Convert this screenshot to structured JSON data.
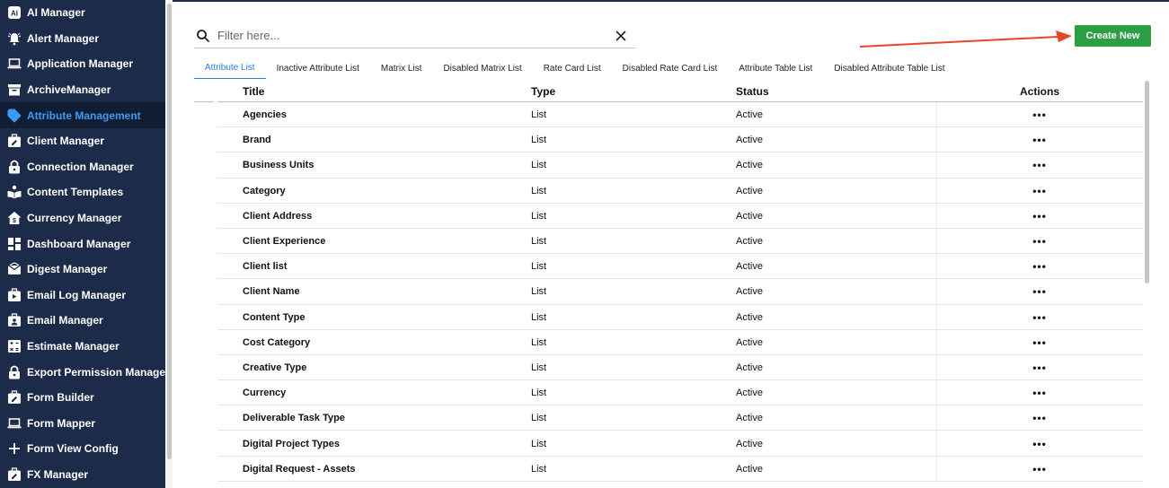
{
  "sidebar": {
    "items": [
      {
        "label": "AI Manager",
        "icon": "ai-icon",
        "active": false
      },
      {
        "label": "Alert Manager",
        "icon": "bell-icon",
        "active": false
      },
      {
        "label": "Application Manager",
        "icon": "laptop-icon",
        "active": false
      },
      {
        "label": "ArchiveManager",
        "icon": "archive-icon",
        "active": false
      },
      {
        "label": "Attribute Management",
        "icon": "tag-icon",
        "active": true
      },
      {
        "label": "Client Manager",
        "icon": "briefcase-edit-icon",
        "active": false
      },
      {
        "label": "Connection Manager",
        "icon": "lock-icon",
        "active": false
      },
      {
        "label": "Content Templates",
        "icon": "book-reader-icon",
        "active": false
      },
      {
        "label": "Currency Manager",
        "icon": "house-dollar-icon",
        "active": false
      },
      {
        "label": "Dashboard Manager",
        "icon": "dashboard-icon",
        "active": false
      },
      {
        "label": "Digest Manager",
        "icon": "digest-icon",
        "active": false
      },
      {
        "label": "Email Log Manager",
        "icon": "briefcase-play-icon",
        "active": false
      },
      {
        "label": "Email Manager",
        "icon": "briefcase-user-icon",
        "active": false
      },
      {
        "label": "Estimate Manager",
        "icon": "calculator-icon",
        "active": false
      },
      {
        "label": "Export Permission Manager",
        "icon": "lock-icon",
        "active": false
      },
      {
        "label": "Form Builder",
        "icon": "briefcase-edit-icon",
        "active": false
      },
      {
        "label": "Form Mapper",
        "icon": "laptop-icon",
        "active": false
      },
      {
        "label": "Form View Config",
        "icon": "plus-icon",
        "active": false
      },
      {
        "label": "FX Manager",
        "icon": "briefcase-edit-icon",
        "active": false
      }
    ]
  },
  "search": {
    "placeholder": "Filter here...",
    "value": ""
  },
  "create_button": {
    "label": "Create New",
    "color": "#2e9e46"
  },
  "tabs": [
    {
      "label": "Attribute List",
      "active": true
    },
    {
      "label": "Inactive Attribute List",
      "active": false
    },
    {
      "label": "Matrix List",
      "active": false
    },
    {
      "label": "Disabled Matrix List",
      "active": false
    },
    {
      "label": "Rate Card List",
      "active": false
    },
    {
      "label": "Disabled Rate Card List",
      "active": false
    },
    {
      "label": "Attribute Table List",
      "active": false
    },
    {
      "label": "Disabled Attribute Table List",
      "active": false
    }
  ],
  "table": {
    "headers": {
      "title": "Title",
      "type": "Type",
      "status": "Status",
      "actions": "Actions"
    },
    "rows": [
      {
        "title": "Agencies",
        "type": "List",
        "status": "Active",
        "actions": "•••"
      },
      {
        "title": "Brand",
        "type": "List",
        "status": "Active",
        "actions": "•••"
      },
      {
        "title": "Business Units",
        "type": "List",
        "status": "Active",
        "actions": "•••"
      },
      {
        "title": "Category",
        "type": "List",
        "status": "Active",
        "actions": "•••"
      },
      {
        "title": "Client Address",
        "type": "List",
        "status": "Active",
        "actions": "•••"
      },
      {
        "title": "Client Experience",
        "type": "List",
        "status": "Active",
        "actions": "•••"
      },
      {
        "title": "Client list",
        "type": "List",
        "status": "Active",
        "actions": "•••"
      },
      {
        "title": "Client Name",
        "type": "List",
        "status": "Active",
        "actions": "•••"
      },
      {
        "title": "Content Type",
        "type": "List",
        "status": "Active",
        "actions": "•••"
      },
      {
        "title": "Cost Category",
        "type": "List",
        "status": "Active",
        "actions": "•••"
      },
      {
        "title": "Creative Type",
        "type": "List",
        "status": "Active",
        "actions": "•••"
      },
      {
        "title": "Currency",
        "type": "List",
        "status": "Active",
        "actions": "•••"
      },
      {
        "title": "Deliverable Task Type",
        "type": "List",
        "status": "Active",
        "actions": "•••"
      },
      {
        "title": "Digital Project Types",
        "type": "List",
        "status": "Active",
        "actions": "•••"
      },
      {
        "title": "Digital Request - Assets",
        "type": "List",
        "status": "Active",
        "actions": "•••"
      }
    ]
  },
  "colors": {
    "sidebar_bg": "#1c2b4a",
    "accent": "#3d9bf5",
    "tab_active": "#2a7de1",
    "arrow": "#e8452c"
  }
}
